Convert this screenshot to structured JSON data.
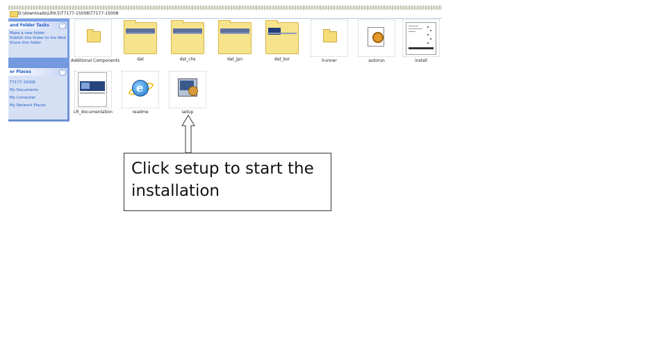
{
  "address_bar": {
    "path": "D:\\downloads\\LR9.5\\T7177-15008\\T7177-15008"
  },
  "task_panes": [
    {
      "title": "and Folder Tasks",
      "items": [
        "Make a new folder",
        "Publish this folder to the Web",
        "Share this folder"
      ]
    },
    {
      "title": "er Places",
      "items": [
        "T7177-15008",
        "My Documents",
        "My Computer",
        "My Network Places"
      ]
    }
  ],
  "files": [
    {
      "label": "Additional Components",
      "icon": "folder-icon"
    },
    {
      "label": "dat",
      "icon": "folder-thumbnail-icon"
    },
    {
      "label": "dat_chs",
      "icon": "folder-thumbnail-icon"
    },
    {
      "label": "dat_jpn",
      "icon": "folder-thumbnail-icon"
    },
    {
      "label": "dat_kor",
      "icon": "folder-thumbnail-icon"
    },
    {
      "label": "lrunner",
      "icon": "folder-icon"
    },
    {
      "label": "autorun",
      "icon": "autorun-icon"
    },
    {
      "label": "install",
      "icon": "document-thumbnail-icon"
    },
    {
      "label": "LR_documentation",
      "icon": "document-thumbnail-icon"
    },
    {
      "label": "readme",
      "icon": "internet-explorer-icon"
    },
    {
      "label": "setup",
      "icon": "setup-icon"
    }
  ],
  "callout": {
    "text": "Click setup to start the installation"
  }
}
